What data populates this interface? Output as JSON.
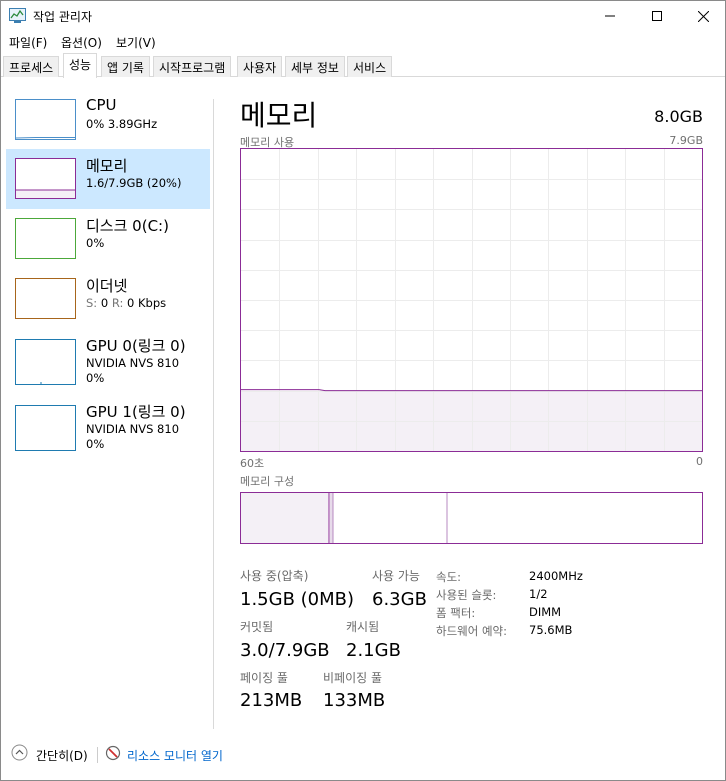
{
  "window": {
    "title": "작업 관리자"
  },
  "menu": {
    "items": [
      "파일(F)",
      "옵션(O)",
      "보기(V)"
    ]
  },
  "tabs": [
    "프로세스",
    "성능",
    "앱 기록",
    "시작프로그램",
    "사용자",
    "세부 정보",
    "서비스"
  ],
  "active_tab": "성능",
  "sidebar": {
    "items": [
      {
        "title": "CPU",
        "line1": "0% 3.89GHz",
        "line2": ""
      },
      {
        "title": "메모리",
        "line1": "1.6/7.9GB (20%)",
        "line2": ""
      },
      {
        "title": "디스크 0(C:)",
        "line1": "0%",
        "line2": ""
      },
      {
        "title": "이더넷",
        "line1_s": "S:",
        "line1_sv": "0",
        "line1_r": "R:",
        "line1_rv": "0 Kbps",
        "line2": ""
      },
      {
        "title": "GPU 0(링크 0)",
        "line1": "NVIDIA NVS 810",
        "line2": "0%"
      },
      {
        "title": "GPU 1(링크 0)",
        "line1": "NVIDIA NVS 810",
        "line2": "0%"
      }
    ],
    "selected_index": 1
  },
  "main": {
    "title": "메모리",
    "total": "8.0GB",
    "usage_label": "메모리 사용",
    "usage_max": "7.9GB",
    "time_left": "60초",
    "time_right": "0",
    "composition_label": "메모리 구성",
    "usage_fraction": 0.2
  },
  "stats": {
    "in_use_label": "사용 중(압축)",
    "in_use_value": "1.5GB (0MB)",
    "available_label": "사용 가능",
    "available_value": "6.3GB",
    "committed_label": "커밋됨",
    "committed_value": "3.0/7.9GB",
    "cached_label": "캐시됨",
    "cached_value": "2.1GB",
    "paged_label": "페이징 풀",
    "paged_value": "213MB",
    "nonpaged_label": "비페이징 풀",
    "nonpaged_value": "133MB"
  },
  "details": [
    {
      "label": "속도:",
      "value": "2400MHz"
    },
    {
      "label": "사용된 슬롯:",
      "value": "1/2"
    },
    {
      "label": "폼 팩터:",
      "value": "DIMM"
    },
    {
      "label": "하드웨어 예약:",
      "value": "75.6MB"
    }
  ],
  "footer": {
    "fewer_details": "간단히(D)",
    "resource_monitor": "리소스 모니터 열기"
  },
  "colors": {
    "memory_accent": "#8b2c96",
    "memory_fill": "#f4f0f6",
    "cpu_accent": "#4b8fc9",
    "disk_accent": "#4ca83a",
    "net_accent": "#a7651b",
    "gpu_accent": "#1f7bb0",
    "selected_bg": "#cce8ff",
    "link": "#0066cc"
  }
}
